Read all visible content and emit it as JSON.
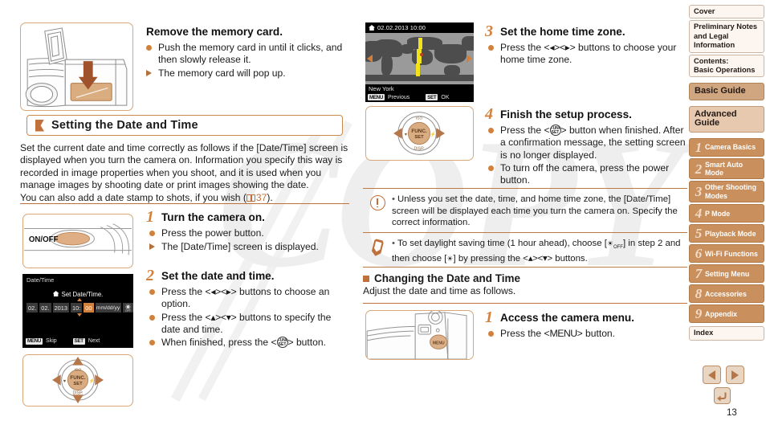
{
  "page": {
    "number": "13",
    "watermark": "COPY"
  },
  "left_column": {
    "memory_card": {
      "title": "Remove the memory card.",
      "bullets": [
        {
          "marker": "dot",
          "text": "Push the memory card in until it clicks, and then slowly release it."
        },
        {
          "marker": "tri",
          "text": "The memory card will pop up."
        }
      ]
    },
    "section": {
      "heading": "Setting the Date and Time",
      "paragraph_1": "Set the current date and time correctly as follows if the [Date/Time] screen is displayed when you turn the camera on. Information you specify this way is recorded in image properties when you shoot, and it is used when you manage images by shooting date or print images showing the date.",
      "paragraph_2_pre": "You can also add a date stamp to shots, if you wish (",
      "paragraph_2_ref": "37",
      "paragraph_2_post": ")."
    },
    "step1": {
      "number": "1",
      "title": "Turn the camera on.",
      "bullets": [
        {
          "marker": "dot",
          "text": "Press the power button."
        },
        {
          "marker": "tri",
          "text": "The [Date/Time] screen is displayed."
        }
      ]
    },
    "step2": {
      "number": "2",
      "title": "Set the date and time.",
      "bullets": [
        {
          "marker": "dot",
          "pre": "Press the <",
          "key": "lr",
          "post": "> buttons to choose an option."
        },
        {
          "marker": "dot",
          "pre": "Press the <",
          "key": "ud",
          "post": "> buttons to specify the date and time."
        },
        {
          "marker": "dot",
          "pre": "When finished, press the <",
          "key": "funcset",
          "post": "> button."
        }
      ]
    },
    "power_illustration": {
      "label": "ON/OFF"
    },
    "datetime_screen": {
      "title": "Date/Time",
      "subtitle": "Set Date/Time.",
      "fields": [
        "02.",
        "02.",
        "2013",
        "10:",
        "00"
      ],
      "selected_index": 4,
      "format": "mm/dd/yy",
      "dst_icon": "daylight-saving-off-icon",
      "left_key": "MENU",
      "left_label": "Skip",
      "right_key": "SET",
      "right_label": "Next"
    }
  },
  "right_column": {
    "map_screen": {
      "home_icon": "home-icon",
      "datetime": "02.02.2013 10:00",
      "city": "New York",
      "left_key": "MENU",
      "left_label": "Previous",
      "right_key": "SET",
      "right_label": "OK"
    },
    "step3": {
      "number": "3",
      "title": "Set the home time zone.",
      "bullets": [
        {
          "marker": "dot",
          "pre": "Press the <",
          "key": "lr",
          "post": "> buttons to choose your home time zone."
        }
      ]
    },
    "step4": {
      "number": "4",
      "title": "Finish the setup process.",
      "bullets": [
        {
          "marker": "dot",
          "pre": "Press the <",
          "key": "funcset",
          "post": "> button when finished. After a confirmation message, the setting screen is no longer displayed."
        },
        {
          "marker": "dot",
          "text": "To turn off the camera, press the power button."
        }
      ]
    },
    "caution_note": {
      "icon": "caution-icon",
      "text": "Unless you set the date, time, and home time zone, the [Date/Time] screen will be displayed each time you turn the camera on. Specify the correct information."
    },
    "pencil_note": {
      "icon": "pencil-note-icon",
      "pre": "To set daylight saving time (1 hour ahead), choose [",
      "mid": "] in step 2 and then choose [",
      "post": "] by pressing the <",
      "tail": "> buttons."
    },
    "changing_section": {
      "heading": "Changing the Date and Time",
      "paragraph": "Adjust the date and time as follows."
    },
    "step_menu": {
      "number": "1",
      "title": "Access the camera menu.",
      "bullet_pre": "Press the <",
      "bullet_key": "MENU",
      "bullet_post": "> button."
    }
  },
  "sidebar": {
    "items": [
      {
        "label": "Cover",
        "style": "plain"
      },
      {
        "label": "Preliminary Notes and Legal Information",
        "style": "plain"
      },
      {
        "label": "Contents:\nBasic Operations",
        "style": "plain"
      },
      {
        "label": "Basic Guide",
        "style": "guide-active"
      },
      {
        "label": "Advanced Guide",
        "style": "guide"
      }
    ],
    "chapters": [
      {
        "num": "1",
        "label": "Camera Basics"
      },
      {
        "num": "2",
        "label": "Smart Auto Mode"
      },
      {
        "num": "3",
        "label": "Other Shooting Modes"
      },
      {
        "num": "4",
        "label": "P Mode"
      },
      {
        "num": "5",
        "label": "Playback Mode"
      },
      {
        "num": "6",
        "label": "Wi-Fi Functions"
      },
      {
        "num": "7",
        "label": "Setting Menu"
      },
      {
        "num": "8",
        "label": "Accessories"
      },
      {
        "num": "9",
        "label": "Appendix"
      }
    ],
    "index": {
      "label": "Index"
    }
  },
  "page_nav": {
    "prev_icon": "previous-page-icon",
    "next_icon": "next-page-icon",
    "back_icon": "back-icon"
  },
  "colors": {
    "accent": "#c0703a",
    "step_number": "#d2813c",
    "sidebar_chapter": "#c98f5d",
    "sidebar_light": "#f0ded0",
    "highlight": "#cfa680"
  }
}
